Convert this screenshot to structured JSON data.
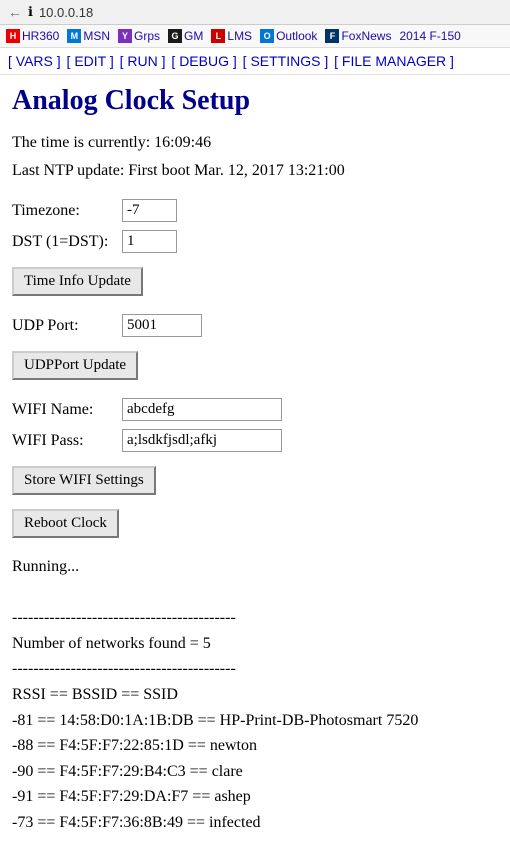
{
  "browser": {
    "url": "10.0.0.18",
    "back_icon": "←",
    "info_icon": "ℹ"
  },
  "bookmarks": [
    {
      "label": "HR360",
      "color": "#cc0000"
    },
    {
      "label": "MSN",
      "color": "#0078d4"
    },
    {
      "label": "Grps",
      "color": "#7B2FBE"
    },
    {
      "label": "GM",
      "color": "#1a1a1a"
    },
    {
      "label": "LMS",
      "color": "#cc0000"
    },
    {
      "label": "Outlook",
      "color": "#0078d4"
    },
    {
      "label": "FoxNews",
      "color": "#003366"
    },
    {
      "label": "2014 F-150",
      "color": "#333"
    }
  ],
  "navbar": {
    "items": [
      "[ VARS ]",
      "[ EDIT ]",
      "[ RUN ]",
      "[ DEBUG ]",
      "[ SETTINGS ]",
      "[ FILE MANAGER ]"
    ]
  },
  "page": {
    "title": "Analog Clock Setup",
    "time_line1": "The time is currently: 16:09:46",
    "time_line2": "Last NTP update: First boot Mar. 12, 2017 13:21:00",
    "timezone_label": "Timezone:",
    "timezone_value": "-7",
    "dst_label": "DST (1=DST):",
    "dst_value": "1",
    "time_update_btn": "Time Info Update",
    "udp_port_label": "UDP Port:",
    "udp_port_value": "5001",
    "udp_update_btn": "UDPPort Update",
    "wifi_name_label": "WIFI Name:",
    "wifi_name_value": "abcdefg",
    "wifi_pass_label": "WIFI Pass:",
    "wifi_pass_value": "a;lsdkfjsdl;afkj",
    "store_wifi_btn": "Store WIFI Settings",
    "reboot_btn": "Reboot Clock",
    "output": "Running...\n\n------------------------------------------\nNumber of networks found = 5\n------------------------------------------\nRSSI == BSSID == SSID\n-81 == 14:58:D0:1A:1B:DB == HP-Print-DB-Photosmart 7520\n-88 == F4:5F:F7:22:85:1D == newton\n-90 == F4:5F:F7:29:B4:C3 == clare\n-91 == F4:5F:F7:29:DA:F7 == ashep\n-73 == F4:5F:F7:36:8B:49 == infected"
  }
}
